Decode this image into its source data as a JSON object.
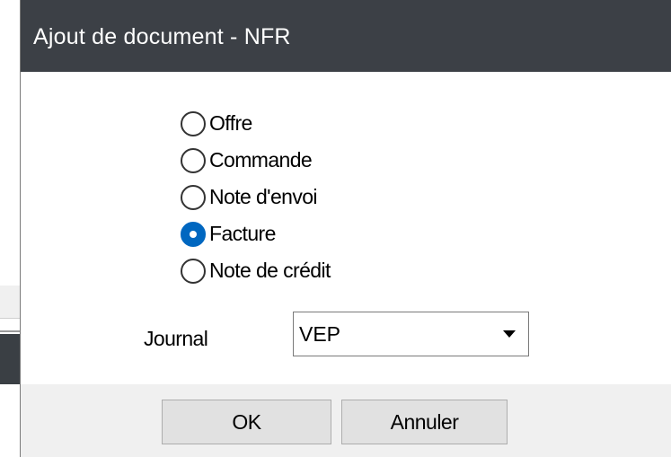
{
  "dialog": {
    "title": "Ajout de document - NFR",
    "document_types": [
      {
        "label": "Offre",
        "checked": false
      },
      {
        "label": "Commande",
        "checked": false
      },
      {
        "label": "Note d'envoi",
        "checked": false
      },
      {
        "label": "Facture",
        "checked": true
      },
      {
        "label": "Note de crédit",
        "checked": false
      }
    ],
    "journal": {
      "label": "Journal",
      "value": "VEP"
    },
    "buttons": {
      "ok_label": "OK",
      "cancel_label": "Annuler"
    }
  },
  "colors": {
    "titlebar": "#3c4046",
    "radio_selected": "#0067c0",
    "footer": "#f0f0f0"
  }
}
